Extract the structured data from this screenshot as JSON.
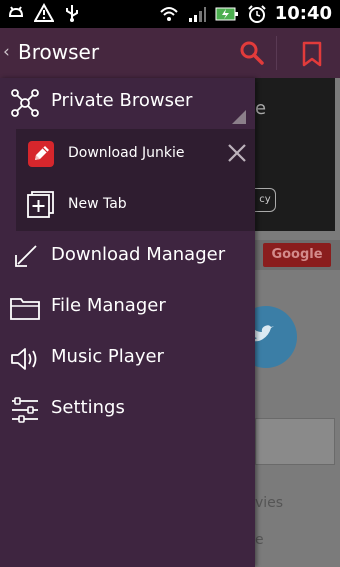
{
  "status_bar": {
    "time": "10:40",
    "icons": [
      "usb-debug-icon",
      "warning-icon",
      "usb-icon",
      "wifi-icon",
      "signal-icon",
      "battery-charging-icon",
      "alarm-icon"
    ]
  },
  "app_bar": {
    "title": "Browser",
    "back_glyph": "‹",
    "accent": "#e23b3b"
  },
  "drawer": {
    "items": [
      {
        "label": "Private Browser",
        "icon": "private-browser-icon"
      },
      {
        "label": "Download Manager",
        "icon": "download-icon"
      },
      {
        "label": "File Manager",
        "icon": "folder-icon"
      },
      {
        "label": "Music Player",
        "icon": "speaker-icon"
      },
      {
        "label": "Settings",
        "icon": "sliders-icon"
      }
    ],
    "tabs": [
      {
        "label": "Download Junkie",
        "icon": "edit-app-icon"
      },
      {
        "label": "New Tab",
        "icon": "new-tab-icon"
      }
    ]
  },
  "background_page": {
    "google_button": "Google",
    "partial_texts": [
      "vies",
      "e"
    ],
    "partial_letter": "e",
    "partial_button": "cy"
  }
}
